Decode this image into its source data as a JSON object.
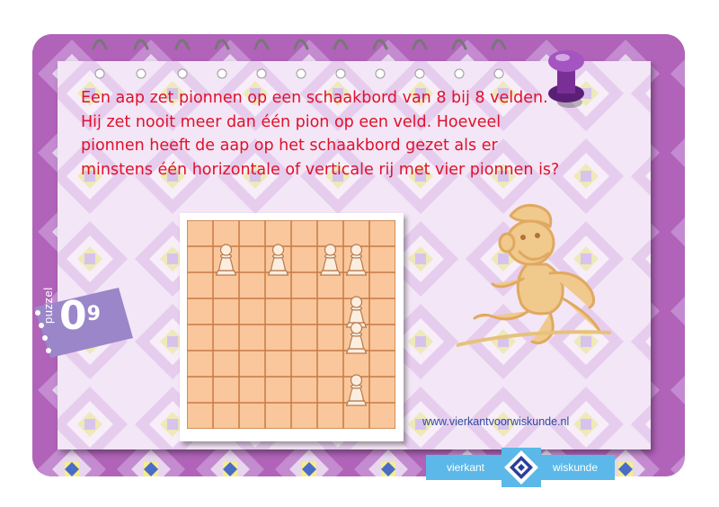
{
  "question": {
    "text": "Een aap zet pionnen op een schaakbord van 8 bij 8 velden. Hij zet nooit meer dan één pion op een veld. Hoeveel pionnen heeft de aap op het schaakbord gezet als er minstens één horizontale of verticale rij met vier pionnen is?"
  },
  "puzzle": {
    "label": "puzzel",
    "number_a": "0",
    "number_b": "9"
  },
  "board": {
    "size": 8,
    "pawns": [
      [
        1,
        1
      ],
      [
        1,
        3
      ],
      [
        1,
        5
      ],
      [
        1,
        6
      ],
      [
        3,
        6
      ],
      [
        4,
        6
      ],
      [
        6,
        6
      ]
    ]
  },
  "footer": {
    "url": "www.vierkantvoorwiskunde.nl",
    "logo_left": "vierkant",
    "logo_right": "wiskunde"
  },
  "colors": {
    "card": "#b063b8",
    "paper": "#f3e6f6",
    "text": "#e0112b",
    "board": "#f9c79b",
    "logo": "#5bb8e8",
    "tag": "#9a86c9",
    "pin": "#7a2f96"
  },
  "icons": [
    "push-pin-icon",
    "monkey-illustration",
    "pawn-icon",
    "vierkant-logo-icon"
  ]
}
